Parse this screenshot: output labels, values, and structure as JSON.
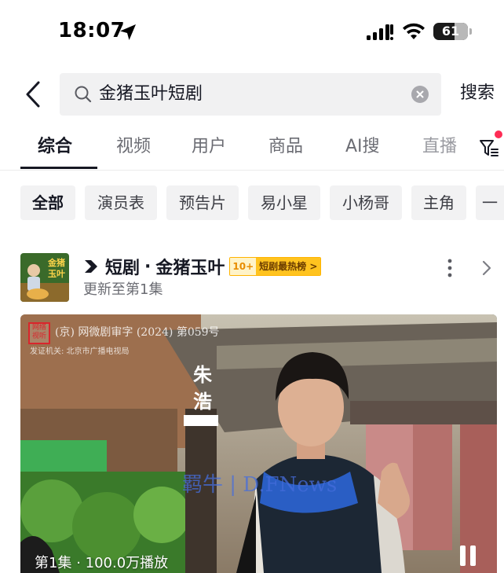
{
  "status_bar": {
    "time": "18:07",
    "battery_level": "61",
    "battery_fraction": 0.61,
    "icons": [
      "location-arrow-icon",
      "signal-icon",
      "wifi-icon",
      "battery-icon"
    ]
  },
  "search": {
    "query": "金猪玉叶短剧",
    "search_button": "搜索",
    "icons": [
      "back-arrow-icon",
      "search-icon",
      "clear-icon"
    ]
  },
  "tabs": [
    {
      "label": "综合",
      "active": true
    },
    {
      "label": "视频",
      "active": false
    },
    {
      "label": "用户",
      "active": false
    },
    {
      "label": "商品",
      "active": false
    },
    {
      "label": "AI搜",
      "active": false
    },
    {
      "label": "直播",
      "active": false
    }
  ],
  "filter": {
    "icon": "filter-icon",
    "has_notification_dot": true
  },
  "chips": [
    {
      "label": "全部",
      "active": true
    },
    {
      "label": "演员表",
      "active": false
    },
    {
      "label": "预告片",
      "active": false
    },
    {
      "label": "易小星",
      "active": false
    },
    {
      "label": "小杨哥",
      "active": false
    },
    {
      "label": "主角",
      "active": false
    },
    {
      "label": "一",
      "active": false
    }
  ],
  "drama": {
    "type_label": "短剧",
    "separator": "·",
    "title": "金猪玉叶",
    "rank_number": "10+",
    "rank_label": "短剧最热榜",
    "rank_arrow": ">",
    "update_text": "更新至第1集",
    "poster_text": "金猪玉叶"
  },
  "video": {
    "license_logo": "网络视听",
    "license_text": "(京) 网微剧审字 (2024) 第059号",
    "issuer_text": "发证机关: 北京市广播电视局",
    "actor_name": "朱浩",
    "watermark": "羁牛 | D.FNews",
    "episode_label": "第1集",
    "separator": "·",
    "play_count": "100.0万播放"
  },
  "colors": {
    "accent_red": "#fe2c55",
    "text_primary": "#161823",
    "text_secondary": "#6b6c73",
    "rank_badge": "#ffc31f"
  }
}
